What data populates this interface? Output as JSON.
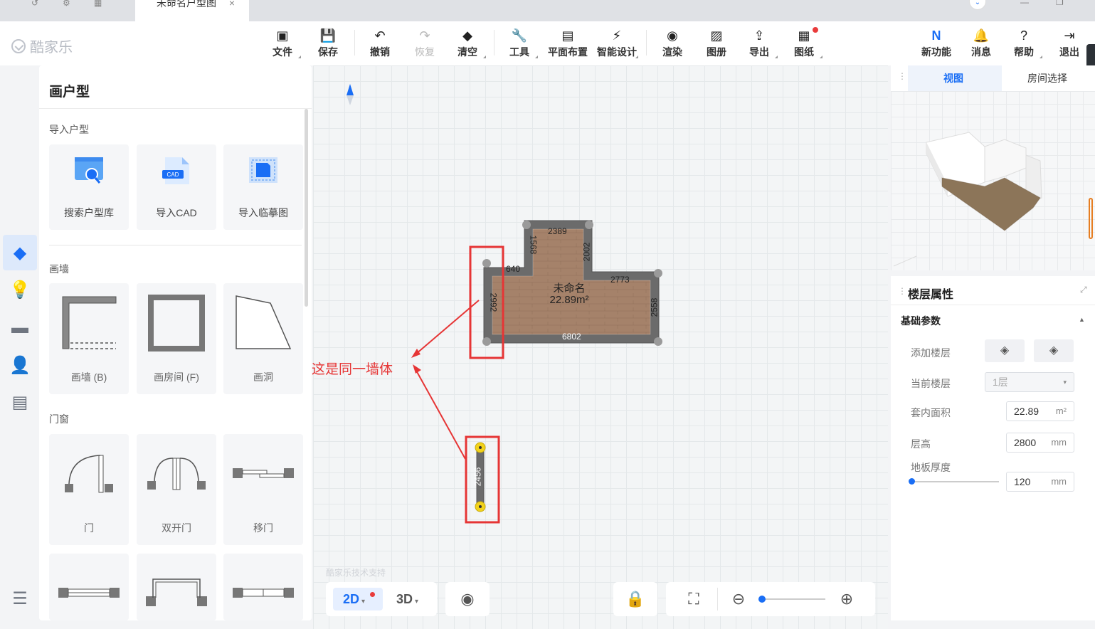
{
  "tabs": {
    "title": "未命名户型图",
    "close": "×"
  },
  "logo": {
    "text": "酷家乐"
  },
  "toolbar": {
    "file": "文件",
    "save": "保存",
    "undo": "撤销",
    "redo": "恢复",
    "clear": "清空",
    "tools": "工具",
    "layout": "平面布置",
    "smart": "智能设计",
    "render": "渲染",
    "album": "图册",
    "export": "导出",
    "drawing": "图纸",
    "new_feature": "新功能",
    "message": "消息",
    "help": "帮助",
    "exit": "退出"
  },
  "left_panel": {
    "title": "画户型",
    "import_section": "导入户型",
    "import_items": [
      "搜索户型库",
      "导入CAD",
      "导入临摹图"
    ],
    "cad_badge": "CAD",
    "wall_section": "画墙",
    "wall_items": [
      "画墙 (B)",
      "画房间 (F)",
      "画洞"
    ],
    "door_section": "门窗",
    "door_items": [
      "门",
      "双开门",
      "移门"
    ]
  },
  "canvas": {
    "room_name": "未命名",
    "room_area": "22.89m²",
    "dims": [
      "2389",
      "1568",
      "2002",
      "640",
      "2773",
      "2992",
      "2558",
      "6802",
      "2456"
    ],
    "annotation": "这是同一墙体",
    "watermark": "酷家乐技术支持"
  },
  "bottom": {
    "mode_2d": "2D",
    "mode_3d": "3D",
    "zoom_level": 0.05
  },
  "right_panel": {
    "tab_view": "视图",
    "tab_room": "房间选择",
    "section_title": "楼层属性",
    "sub_title": "基础参数",
    "add_floor_label": "添加楼层",
    "current_floor_label": "当前楼层",
    "current_floor_value": "1层",
    "area_label": "套内面积",
    "area_value": "22.89",
    "area_unit": "m²",
    "height_label": "层高",
    "height_value": "2800",
    "height_unit": "mm",
    "floor_thickness_label": "地板厚度",
    "floor_thickness_value": "120",
    "floor_thickness_unit": "mm"
  },
  "colors": {
    "accent": "#1a6ef5",
    "annotation": "#e63535",
    "wall": "#6b6b6b",
    "floor": "#a5826a",
    "highlight": "#f2d21a"
  }
}
